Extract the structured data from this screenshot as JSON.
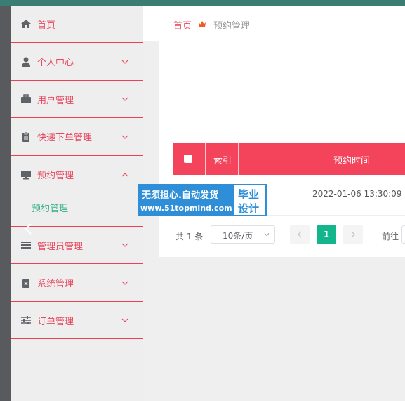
{
  "sidebar": {
    "home": "首页",
    "items": [
      {
        "label": "个人中心",
        "icon": "person-icon"
      },
      {
        "label": "用户管理",
        "icon": "briefcase-icon"
      },
      {
        "label": "快递下单管理",
        "icon": "clipboard-icon"
      },
      {
        "label": "预约管理",
        "icon": "monitor-icon",
        "expanded": true
      },
      {
        "label": "管理员管理",
        "icon": "list-icon"
      },
      {
        "label": "系统管理",
        "icon": "clipboard-x-icon"
      },
      {
        "label": "订单管理",
        "icon": "sliders-icon"
      }
    ],
    "sub_item": "预约管理"
  },
  "breadcrumb": {
    "home": "首页",
    "current": "预约管理"
  },
  "table": {
    "headers": [
      "索引",
      "预约时间"
    ],
    "rows": [
      {
        "time": "2022-01-06 13:30:09"
      }
    ]
  },
  "pagination": {
    "total": "共 1 条",
    "page_size": "10条/页",
    "current_page": "1",
    "goto": "前往"
  },
  "watermark": {
    "line1": "无须担心.自动发货",
    "line2": "www.51topmind.com",
    "right_top": "毕业",
    "right_bottom": "设计"
  },
  "colors": {
    "accent": "#ee3f57",
    "table_header": "#f4445c",
    "active": "#13b58d",
    "sub_active": "#37b08a"
  }
}
